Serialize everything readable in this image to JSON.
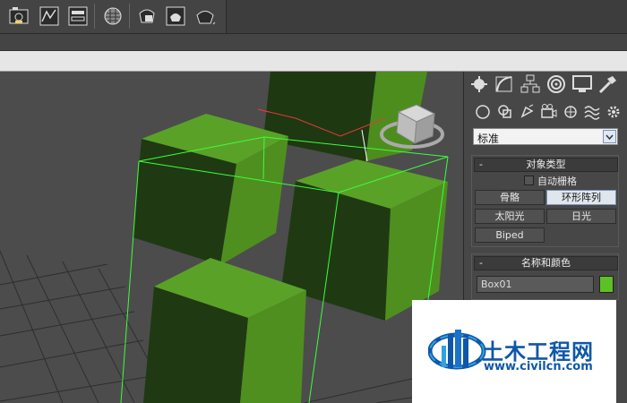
{
  "toolbar": {
    "icons": [
      "render-frame-window-icon",
      "curve-editor-icon",
      "schematic-view-icon",
      "material-editor-icon",
      "render-setup-icon",
      "rendered-frame-icon",
      "render-production-icon"
    ]
  },
  "command_panel": {
    "tabs_row1": [
      "create-tab-icon",
      "modify-tab-icon",
      "hierarchy-tab-icon",
      "motion-tab-icon",
      "display-tab-icon",
      "utilities-tab-icon"
    ],
    "tabs_row2": [
      "geometry-icon",
      "shapes-icon",
      "lights-icon",
      "cameras-icon",
      "helpers-icon",
      "space-warps-icon",
      "systems-icon"
    ],
    "category_dropdown": "标准",
    "object_type": {
      "title": "对象类型",
      "autogrid_label": "自动栅格",
      "buttons": [
        "骨骼",
        "环形阵列",
        "太阳光",
        "日光",
        "Biped"
      ],
      "active_button": "环形阵列"
    },
    "name_color": {
      "title": "名称和颜色",
      "name_value": "Box01",
      "color": "#5dc125"
    },
    "rollout_minus": "-"
  },
  "colors": {
    "cube_top": "#5aa227",
    "cube_side": "#4f8f1f",
    "cube_front": "#1f3a12",
    "selection": "#3cff3c"
  },
  "watermark": {
    "text_cn": "土木工程网",
    "url": "www.civilcn.com"
  }
}
